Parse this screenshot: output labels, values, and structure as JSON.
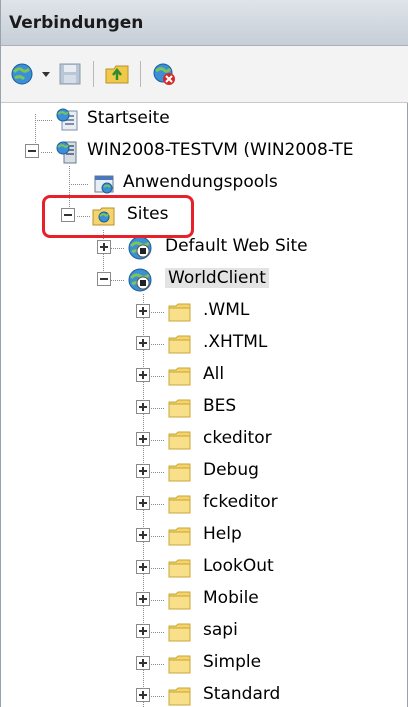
{
  "panel": {
    "title": "Verbindungen"
  },
  "toolbar": {
    "buttons": [
      "connect-globe-icon",
      "dropdown-arrow-icon",
      "save-icon",
      "up-folder-icon",
      "delete-connection-icon"
    ]
  },
  "tree": {
    "startseite": "Startseite",
    "server": "WIN2008-TESTVM (WIN2008-TE",
    "apppools": "Anwendungspools",
    "sites": "Sites",
    "default_site": "Default Web Site",
    "worldclient": "WorldClient",
    "folders": [
      ".WML",
      ".XHTML",
      "All",
      "BES",
      "ckeditor",
      "Debug",
      "fckeditor",
      "Help",
      "LookOut",
      "Mobile",
      "sapi",
      "Simple",
      "Standard"
    ]
  },
  "colors": {
    "highlight": "#e8202a",
    "folder": "#f4d46b"
  }
}
